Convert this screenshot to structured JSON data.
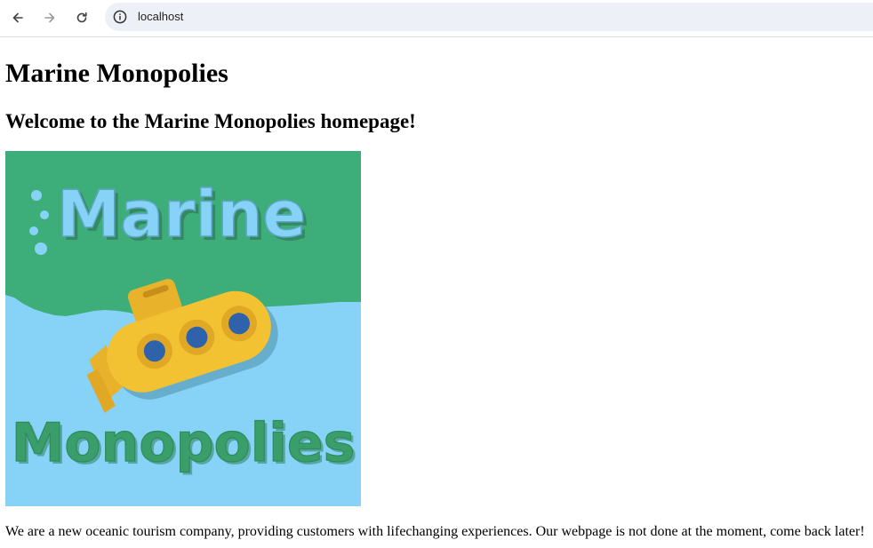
{
  "browser": {
    "address": "localhost",
    "icons": {
      "back": "arrow-left-icon",
      "forward": "arrow-right-icon",
      "reload": "reload-icon",
      "info": "info-icon"
    }
  },
  "page": {
    "title": "Marine Monopolies",
    "subtitle": "Welcome to the Marine Monopolies homepage!",
    "logo": {
      "word_top": "Marine",
      "word_bottom": "Monopolies",
      "colors": {
        "sky": "#3dae7a",
        "water": "#87d3f8",
        "submarine": "#f3c232",
        "porthole": "#2e63ac",
        "text_top": "#87d3f8",
        "text_bottom": "#3a9e6a"
      }
    },
    "intro": "We are a new oceanic tourism company, providing customers with lifechanging experiences. Our webpage is not done at the moment, come back later!"
  }
}
